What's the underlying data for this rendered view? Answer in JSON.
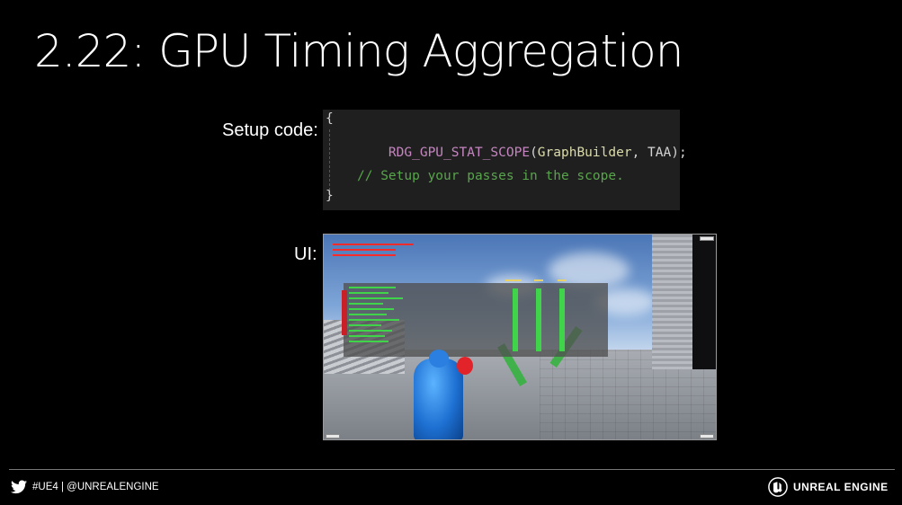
{
  "slide": {
    "title": "2.22: GPU Timing Aggregation",
    "setup_label": "Setup code:",
    "ui_label": "UI:"
  },
  "code": {
    "open_brace": "{",
    "call_fn": "RDG_GPU_STAT_SCOPE",
    "call_paren_open": "(",
    "call_arg1": "GraphBuilder",
    "call_sep": ", ",
    "call_arg2": "TAA",
    "call_end": ");",
    "comment": "// Setup your passes in the scope.",
    "close_brace": "}"
  },
  "footer": {
    "social_text": "#UE4 | @UNREALENGINE",
    "brand": "UNREAL ENGINE"
  },
  "colors": {
    "background": "#000000",
    "code_bg": "#1f1f1f",
    "macro": "#c586c0",
    "type": "#dcdcaa",
    "comment": "#57a64a"
  },
  "icons": {
    "social": "twitter-icon",
    "brand": "unreal-engine-logo-icon"
  }
}
